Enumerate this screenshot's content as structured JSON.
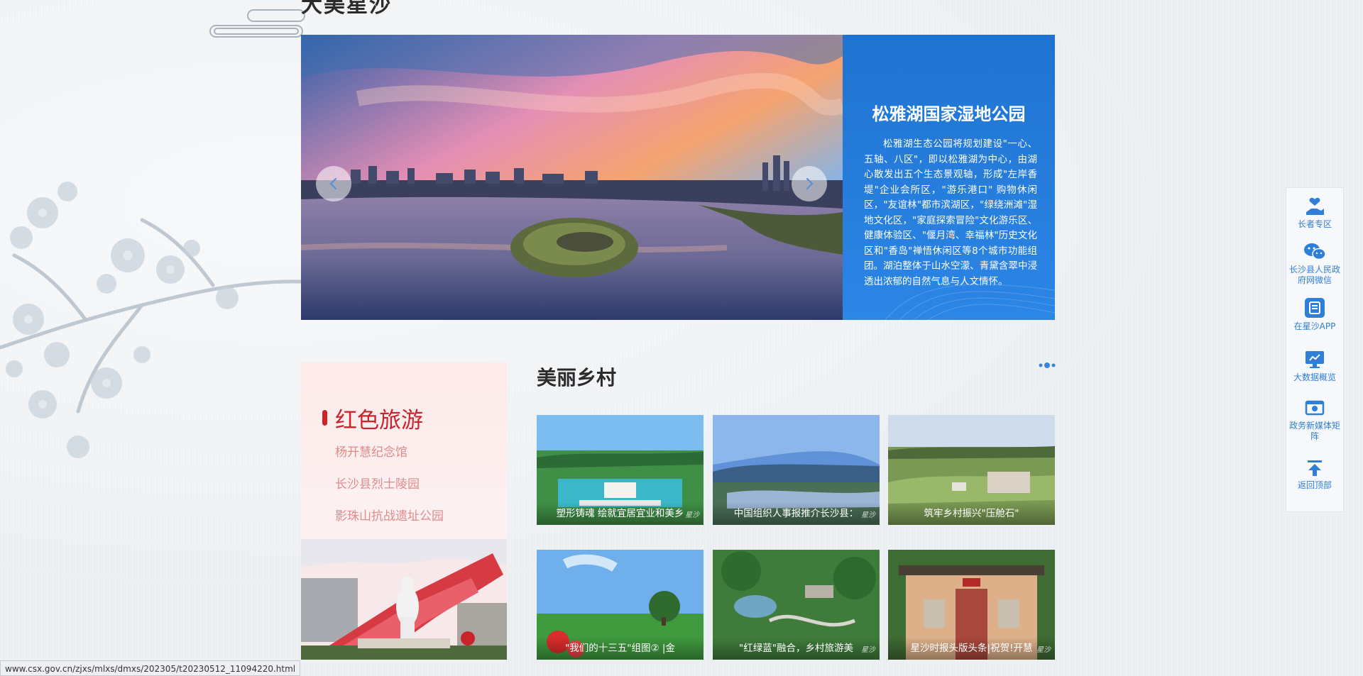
{
  "section_top": {
    "title": "大美星沙"
  },
  "banner": {
    "title": "松雅湖国家湿地公园",
    "description": "松雅湖生态公园将规划建设\"一心、五轴、八区\"，即以松雅湖为中心，由湖心散发出五个生态景观轴，形成\"左岸香堤\"企业会所区，\"游乐港口\" 购物休闲区，\"友谊林\"都市滨湖区，\"绿绕洲滩\"湿地文化区，\"家庭探索冒险\"文化游乐区、健康体验区、\"偃月湾、幸福林\"历史文化区和\"香岛\"禅悟休闲区等8个城市功能组团。湖泊整体于山水空濛、青黛含翠中浸透出浓郁的自然气息与人文情怀。",
    "prev_icon": "chevron-left-icon",
    "next_icon": "chevron-right-icon"
  },
  "red_tourism": {
    "title": "红色旅游",
    "links": [
      "杨开慧纪念馆",
      "长沙县烈士陵园",
      "影珠山抗战遗址公园"
    ]
  },
  "villages": {
    "title": "美丽乡村",
    "more_icon": "more-dots-icon",
    "items": [
      {
        "caption": "塑形铸魂 绘就宜居宜业和美乡",
        "watermark": "星沙"
      },
      {
        "caption": "中国组织人事报推介长沙县：",
        "watermark": "星沙"
      },
      {
        "caption": "筑牢乡村振兴\"压舱石\"",
        "watermark": ""
      },
      {
        "caption": "\"我们的十三五\"组图② |金",
        "watermark": ""
      },
      {
        "caption": "\"红绿蓝\"融合，乡村旅游美",
        "watermark": "星沙"
      },
      {
        "caption": "星沙时报头版头条|祝贺!开慧",
        "watermark": "星沙"
      }
    ]
  },
  "side_toolbar": {
    "items": [
      {
        "label": "长者专区",
        "icon": "elder-care-icon"
      },
      {
        "label": "长沙县人民政府网微信",
        "icon": "wechat-icon"
      },
      {
        "label": "在星沙APP",
        "icon": "app-icon"
      },
      {
        "label": "大数据概览",
        "icon": "data-screen-icon"
      },
      {
        "label": "政务新媒体矩阵",
        "icon": "media-matrix-icon"
      },
      {
        "label": "返回顶部",
        "icon": "back-to-top-icon"
      }
    ]
  },
  "status_bar": {
    "url": "www.csx.gov.cn/zjxs/mlxs/dmxs/202305/t20230512_11094220.html"
  },
  "colors": {
    "accent_blue": "#1f73d0",
    "red": "#c9242b",
    "side_blue": "#2f7fd8"
  }
}
